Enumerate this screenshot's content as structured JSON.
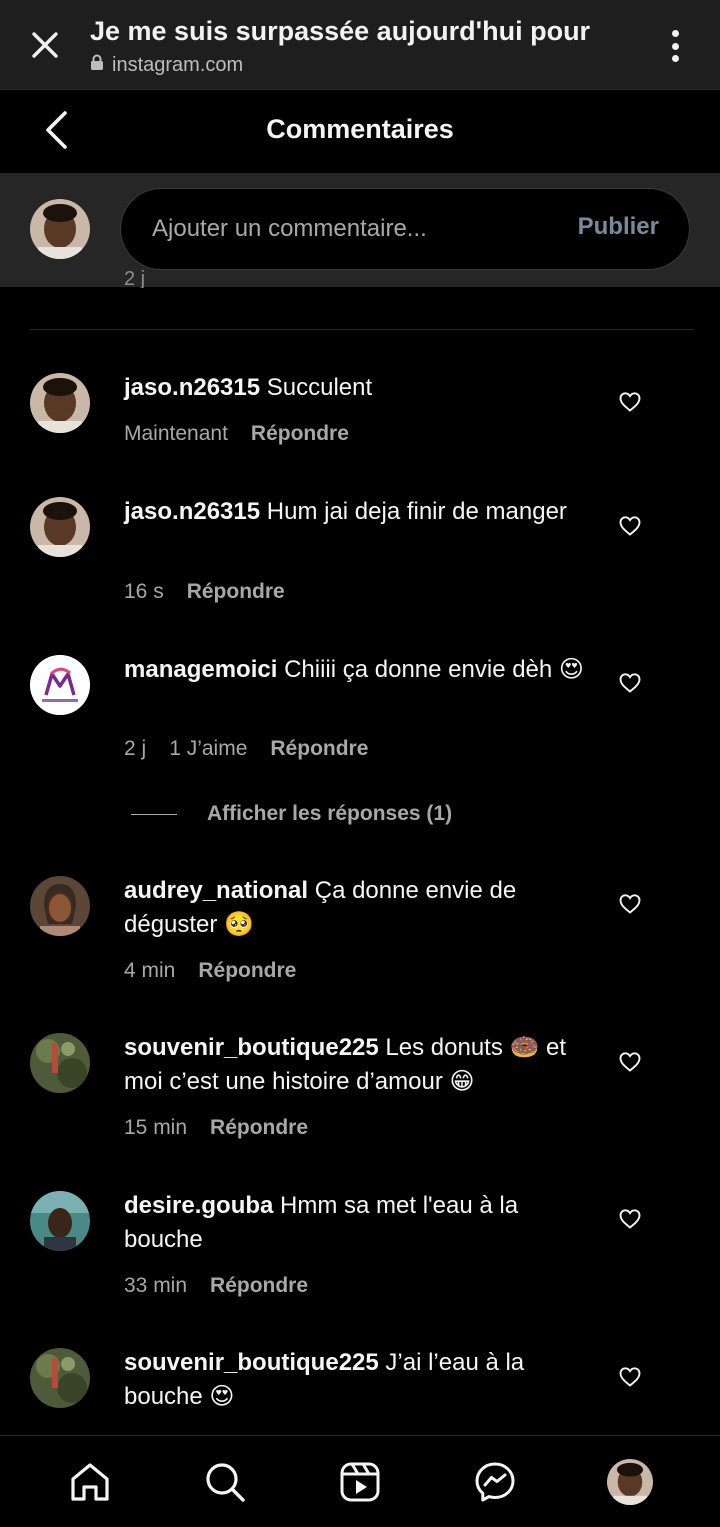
{
  "browser": {
    "title": "Je me suis surpassée aujourd'hui pour",
    "url": "instagram.com"
  },
  "header": {
    "title": "Commentaires"
  },
  "compose": {
    "placeholder": "Ajouter un commentaire...",
    "publish_label": "Publier"
  },
  "partial_meta": "2 j",
  "reply_label": "Répondre",
  "comments": [
    {
      "user": "jaso.n26315",
      "text": "Succulent",
      "time": "Maintenant",
      "likes": ""
    },
    {
      "user": "jaso.n26315",
      "text": "Hum jai deja finir de manger",
      "time": "16 s",
      "likes": ""
    },
    {
      "user": "managemoici",
      "text": "Chiiii ça donne envie dèh 😍",
      "time": "2 j",
      "likes": "1 J’aime"
    },
    {
      "user": "audrey_national",
      "text": "Ça donne envie de déguster 🥺",
      "time": "4 min",
      "likes": ""
    },
    {
      "user": "souvenir_boutique225",
      "text": "Les donuts 🍩 et moi c’est une histoire d’amour 😁",
      "time": "15 min",
      "likes": ""
    },
    {
      "user": "desire.gouba",
      "text": "Hmm sa met l'eau à la bouche",
      "time": "33 min",
      "likes": ""
    },
    {
      "user": "souvenir_boutique225",
      "text": "J’ai l’eau à la bouche 😍",
      "time": "",
      "likes": ""
    }
  ],
  "view_replies": "Afficher les réponses (1)",
  "icons": {
    "close": "close-icon",
    "lock": "lock-icon",
    "menu": "more-vertical-icon",
    "back": "chevron-left-icon",
    "heart": "heart-icon",
    "home": "home-icon",
    "search": "search-icon",
    "reels": "reels-icon",
    "messenger": "messenger-icon"
  },
  "colors": {
    "background": "#000000",
    "surface": "#262626",
    "text": "#f5f5f5",
    "muted": "#a8a8a8",
    "publish": "#7a8a9a"
  }
}
